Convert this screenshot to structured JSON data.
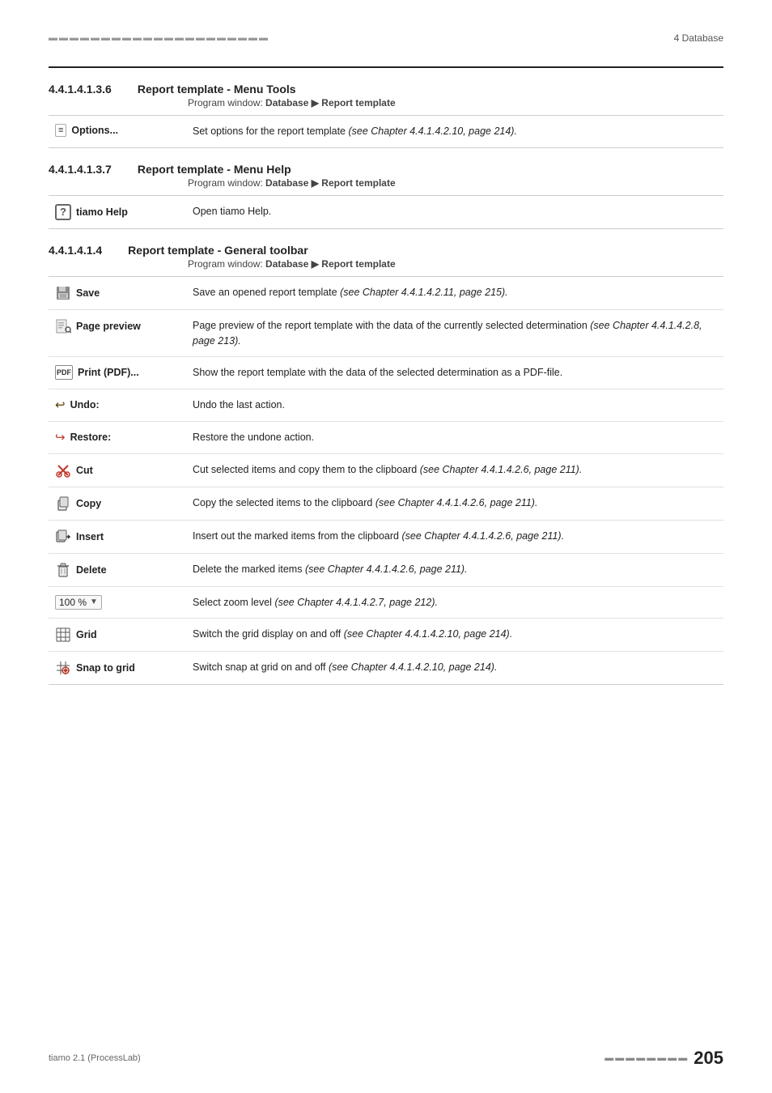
{
  "header": {
    "dots": "▬▬▬▬▬▬▬▬▬▬▬▬▬▬▬▬▬▬▬▬▬",
    "chapter": "4 Database"
  },
  "sections": [
    {
      "id": "section-4416",
      "number": "4.4.1.4.1.3.6",
      "title": "Report template - Menu Tools",
      "subtitle_prefix": "Program window: ",
      "subtitle_bold": "Database ▶ Report template",
      "table": [
        {
          "icon": "options",
          "label": "Options...",
          "label_bold": true,
          "description": "Set options for the report template ",
          "description_italic": "(see Chapter 4.4.1.4.2.10, page 214)."
        }
      ]
    },
    {
      "id": "section-4417",
      "number": "4.4.1.4.1.3.7",
      "title": "Report template - Menu Help",
      "subtitle_prefix": "Program window: ",
      "subtitle_bold": "Database ▶ Report template",
      "table": [
        {
          "icon": "question",
          "label": "tiamo Help",
          "label_bold": true,
          "description": "Open tiamo Help.",
          "description_italic": ""
        }
      ]
    },
    {
      "id": "section-4414",
      "number": "4.4.1.4.1.4",
      "title": "Report template - General toolbar",
      "subtitle_prefix": "Program window: ",
      "subtitle_bold": "Database ▶ Report template",
      "table": [
        {
          "icon": "save",
          "label": "Save",
          "label_bold": true,
          "description": "Save an opened report template ",
          "description_italic": "(see Chapter 4.4.1.4.2.11, page 215)."
        },
        {
          "icon": "preview",
          "label": "Page preview",
          "label_bold": true,
          "description": "Page preview of the report template with the data of the currently selected determination ",
          "description_italic": "(see Chapter 4.4.1.4.2.8, page 213)."
        },
        {
          "icon": "pdf",
          "label": "Print (PDF)...",
          "label_bold": true,
          "description": "Show the report template with the data of the selected determination as a PDF-file.",
          "description_italic": ""
        },
        {
          "icon": "undo",
          "label": "Undo:",
          "label_bold": true,
          "description": "Undo the last action.",
          "description_italic": ""
        },
        {
          "icon": "restore",
          "label": "Restore:",
          "label_bold": true,
          "description": "Restore the undone action.",
          "description_italic": ""
        },
        {
          "icon": "cut",
          "label": "Cut",
          "label_bold": true,
          "description": "Cut selected items and copy them to the clipboard ",
          "description_italic": "(see Chapter 4.4.1.4.2.6, page 211)."
        },
        {
          "icon": "copy",
          "label": "Copy",
          "label_bold": true,
          "description": "Copy the selected items to the clipboard ",
          "description_italic": "(see Chapter 4.4.1.4.2.6, page 211)."
        },
        {
          "icon": "insert",
          "label": "Insert",
          "label_bold": true,
          "description": "Insert out the marked items from the clipboard ",
          "description_italic": "(see Chapter 4.4.1.4.2.6, page 211)."
        },
        {
          "icon": "delete",
          "label": "Delete",
          "label_bold": true,
          "description": "Delete the marked items ",
          "description_italic": "(see Chapter 4.4.1.4.2.6, page 211)."
        },
        {
          "icon": "zoom",
          "label": "100 %",
          "label_bold": false,
          "description": "Select zoom level ",
          "description_italic": "(see Chapter 4.4.1.4.2.7, page 212)."
        },
        {
          "icon": "grid",
          "label": "Grid",
          "label_bold": true,
          "description": "Switch the grid display on and off ",
          "description_italic": "(see Chapter 4.4.1.4.2.10, page 214)."
        },
        {
          "icon": "snap",
          "label": "Snap to grid",
          "label_bold": true,
          "description": "Switch snap at grid on and off ",
          "description_italic": "(see Chapter 4.4.1.4.2.10, page 214)."
        }
      ]
    }
  ],
  "footer": {
    "left": "tiamo 2.1 (ProcessLab)",
    "dots": "▬▬▬▬▬▬▬▬",
    "page": "205"
  }
}
